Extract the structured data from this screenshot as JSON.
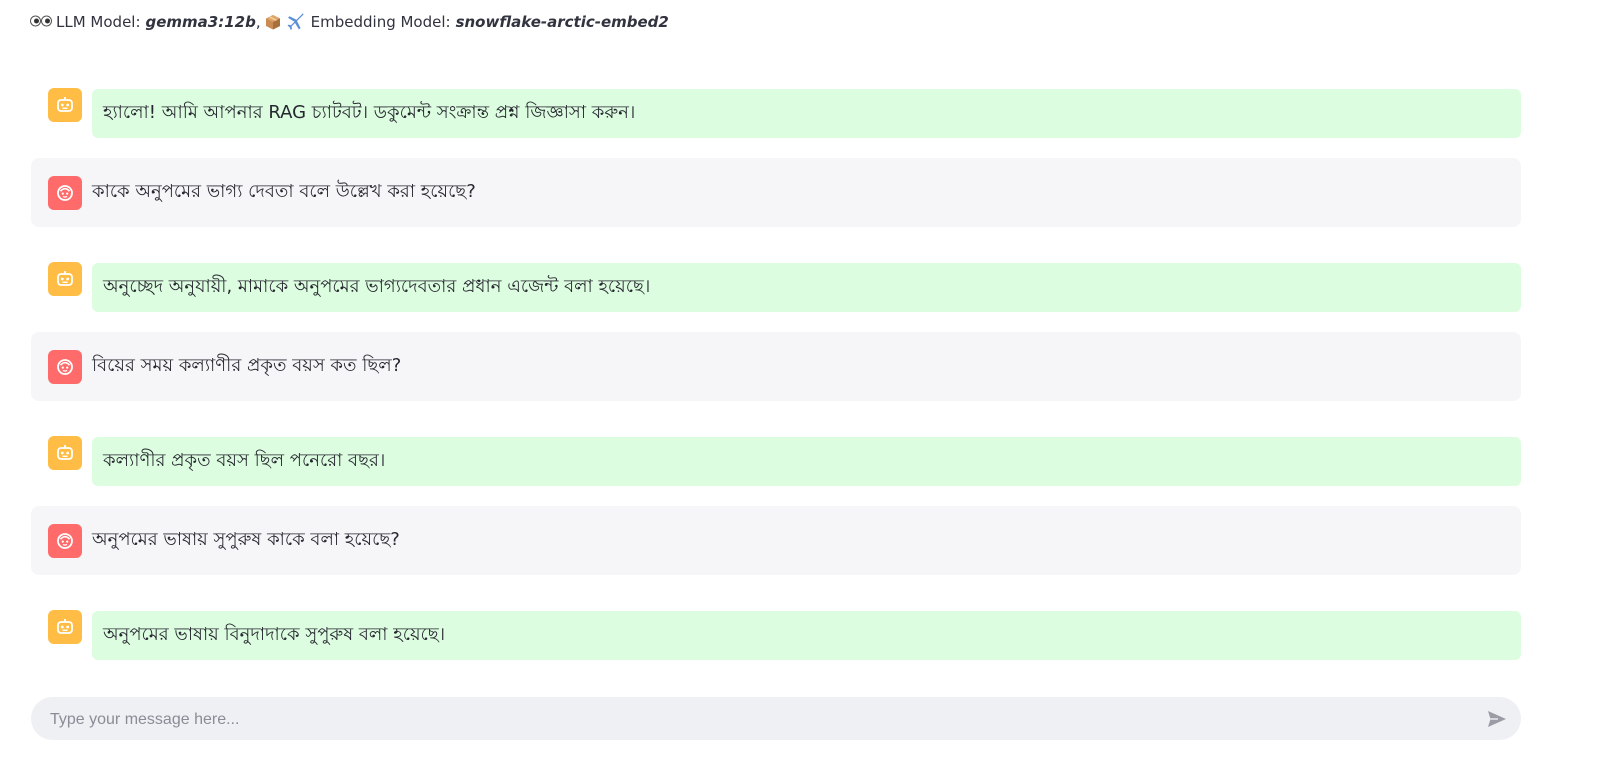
{
  "header": {
    "llm_label": "LLM Model:",
    "llm_value": "gemma3:12b",
    "separator": ",",
    "embedding_label": "Embedding Model:",
    "embedding_value": "snowflake-arctic-embed2",
    "llm_icon": "eyes-emoji",
    "embedding_icons": [
      "package-emoji",
      "airplane-emoji"
    ]
  },
  "messages": [
    {
      "role": "assistant",
      "text": "হ্যালো! আমি আপনার RAG চ্যাটবট। ডকুমেন্ট সংক্রান্ত প্রশ্ন জিজ্ঞাসা করুন।"
    },
    {
      "role": "user",
      "text": "কাকে অনুপমের ভাগ্য দেবতা বলে উল্লেখ করা হয়েছে?"
    },
    {
      "role": "assistant",
      "text": "অনুচ্ছেদ অনুযায়ী, মামাকে অনুপমের ভাগ্যদেবতার প্রধান এজেন্ট বলা হয়েছে।"
    },
    {
      "role": "user",
      "text": "বিয়ের সময় কল্যাণীর প্রকৃত বয়স কত ছিল?"
    },
    {
      "role": "assistant",
      "text": "কল্যাণীর প্রকৃত বয়স ছিল পনেরো বছর।"
    },
    {
      "role": "user",
      "text": "অনুপমের ভাষায় সুপুরুষ কাকে বলা হয়েছে?"
    },
    {
      "role": "assistant",
      "text": "অনুপমের ভাষায় বিনুদাদাকে সুপুরুষ বলা হয়েছে।"
    }
  ],
  "input": {
    "placeholder": "Type your message here...",
    "value": ""
  },
  "colors": {
    "assistant_avatar": "#ffbd45",
    "user_avatar": "#ff6b6b",
    "assistant_bubble": "#ddfde0",
    "user_bubble": "#f6f6f8",
    "input_bg": "#eff0f4"
  }
}
